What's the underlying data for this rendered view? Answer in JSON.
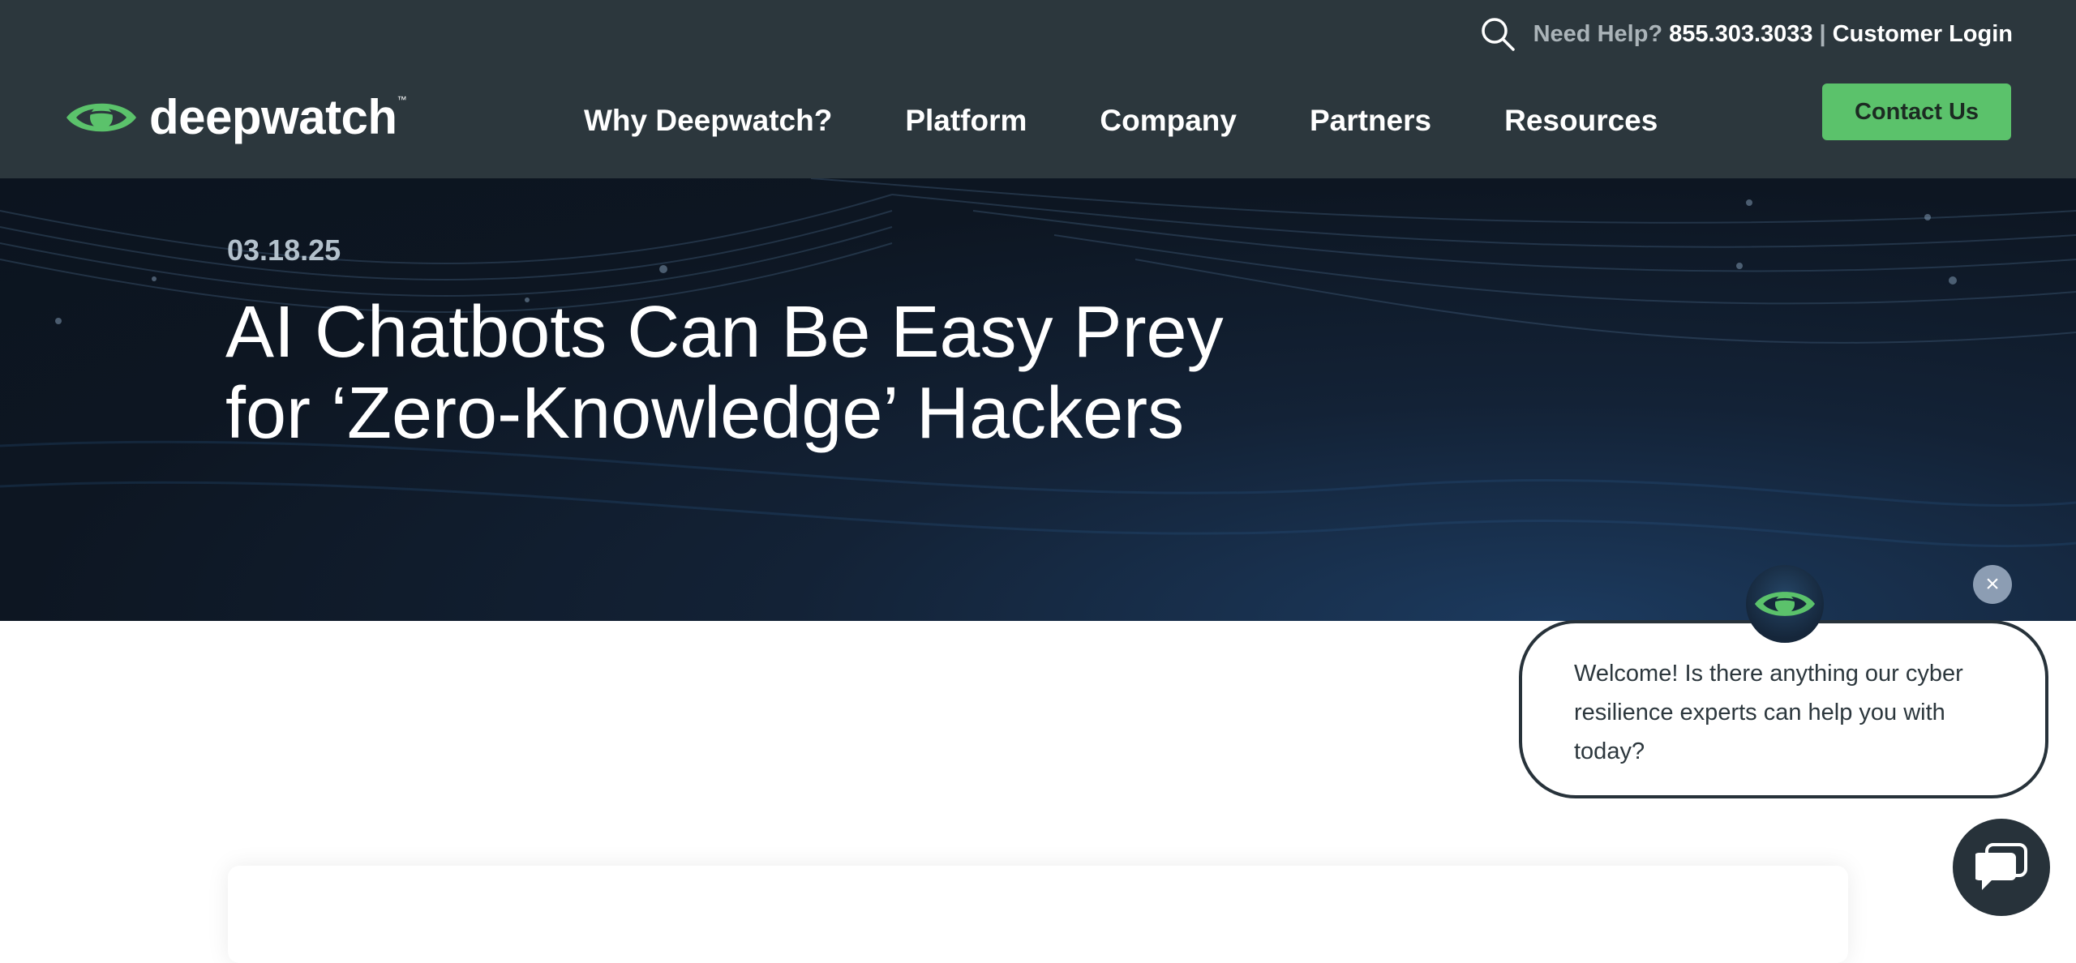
{
  "header": {
    "help_label": "Need Help?",
    "phone": "855.303.3033",
    "separator": "|",
    "login_label": "Customer Login",
    "logo_text": "deepwatch",
    "logo_tm": "™",
    "nav": [
      {
        "label": "Why Deepwatch?"
      },
      {
        "label": "Platform"
      },
      {
        "label": "Company"
      },
      {
        "label": "Partners"
      },
      {
        "label": "Resources"
      }
    ],
    "contact_label": "Contact Us"
  },
  "hero": {
    "date": "03.18.25",
    "title_line1": "AI Chatbots Can Be Easy Prey",
    "title_line2": "for ‘Zero-Knowledge’ Hackers"
  },
  "chat": {
    "message": "Welcome! Is there anything our cyber resilience experts can help you with today?",
    "close_glyph": "×"
  },
  "colors": {
    "header_bg": "#2c373d",
    "brand_green": "#5bc26b",
    "hero_bg": "#0d1622",
    "chat_border": "#27323a"
  },
  "icons": [
    "search-icon",
    "deepwatch-eye-logo-icon",
    "close-icon",
    "chat-bubble-icon"
  ]
}
